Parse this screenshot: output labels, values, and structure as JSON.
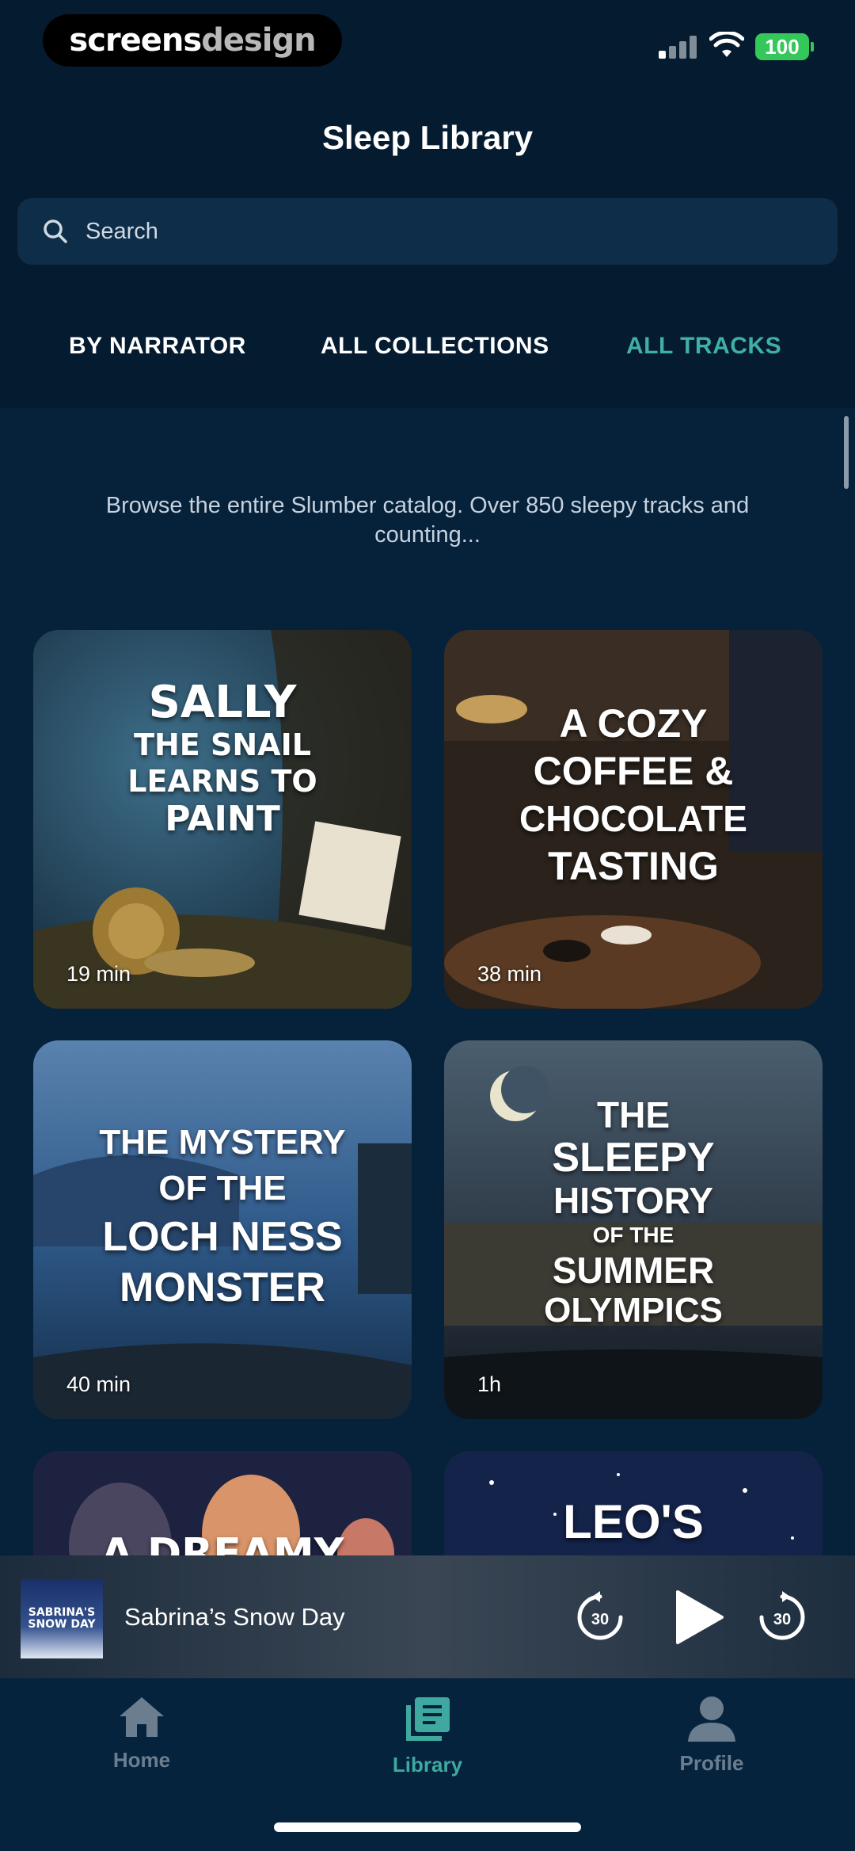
{
  "status_bar": {
    "brand_a": "screens",
    "brand_b": "design",
    "battery": "100"
  },
  "header": {
    "title": "Sleep Library",
    "search_placeholder": "Search"
  },
  "tabs": [
    {
      "label": "BY NARRATOR",
      "active": false
    },
    {
      "label": "ALL COLLECTIONS",
      "active": false
    },
    {
      "label": "ALL TRACKS",
      "active": true
    }
  ],
  "intro_text": "Browse the entire Slumber catalog. Over 850 sleepy tracks and counting...",
  "tracks": [
    {
      "title_lines": [
        "Sally",
        "the Snail",
        "Learns to",
        "Paint"
      ],
      "duration": "19 min"
    },
    {
      "title_lines": [
        "A Cozy",
        "Coffee &",
        "Chocolate",
        "Tasting"
      ],
      "duration": "38 min"
    },
    {
      "title_lines": [
        "The Mystery",
        "of the",
        "Loch Ness",
        "Monster"
      ],
      "duration": "40 min"
    },
    {
      "title_lines": [
        "The",
        "Sleepy",
        "History",
        "of the",
        "Summer",
        "Olympics"
      ],
      "duration": "1h"
    },
    {
      "title_lines": [
        "A Dreamy"
      ],
      "duration": ""
    },
    {
      "title_lines": [
        "Leo's"
      ],
      "duration": ""
    }
  ],
  "now_playing": {
    "thumb_text": "SABRINA'S SNOW DAY",
    "title": "Sabrina’s Snow Day",
    "skip_seconds": "30"
  },
  "nav": [
    {
      "label": "Home",
      "icon": "home-icon",
      "active": false
    },
    {
      "label": "Library",
      "icon": "library-icon",
      "active": true
    },
    {
      "label": "Profile",
      "icon": "profile-icon",
      "active": false
    }
  ],
  "colors": {
    "background": "#041b30",
    "accent": "#3fb0a3",
    "battery": "#34c759"
  }
}
